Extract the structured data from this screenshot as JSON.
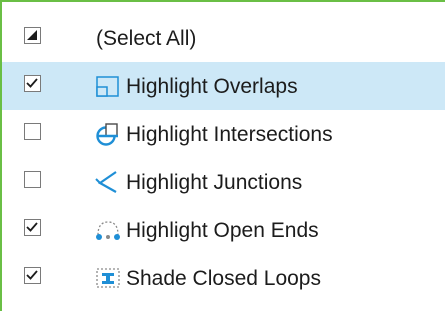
{
  "filter_list": {
    "items": [
      {
        "label": "(Select All)",
        "state": "indeterminate",
        "icon": null
      },
      {
        "label": "Highlight Overlaps",
        "state": "checked",
        "icon": "overlap-square-icon",
        "selected": true
      },
      {
        "label": "Highlight Intersections",
        "state": "unchecked",
        "icon": "intersection-circle-square-icon"
      },
      {
        "label": "Highlight Junctions",
        "state": "unchecked",
        "icon": "junction-chevron-icon"
      },
      {
        "label": "Highlight Open Ends",
        "state": "checked",
        "icon": "open-ends-dots-icon"
      },
      {
        "label": "Shade Closed Loops",
        "state": "checked",
        "icon": "closed-loop-dotted-icon"
      }
    ]
  },
  "colors": {
    "accent_border": "#6abf45",
    "selection": "#cde8f7",
    "icon_blue": "#1f8fd6"
  }
}
